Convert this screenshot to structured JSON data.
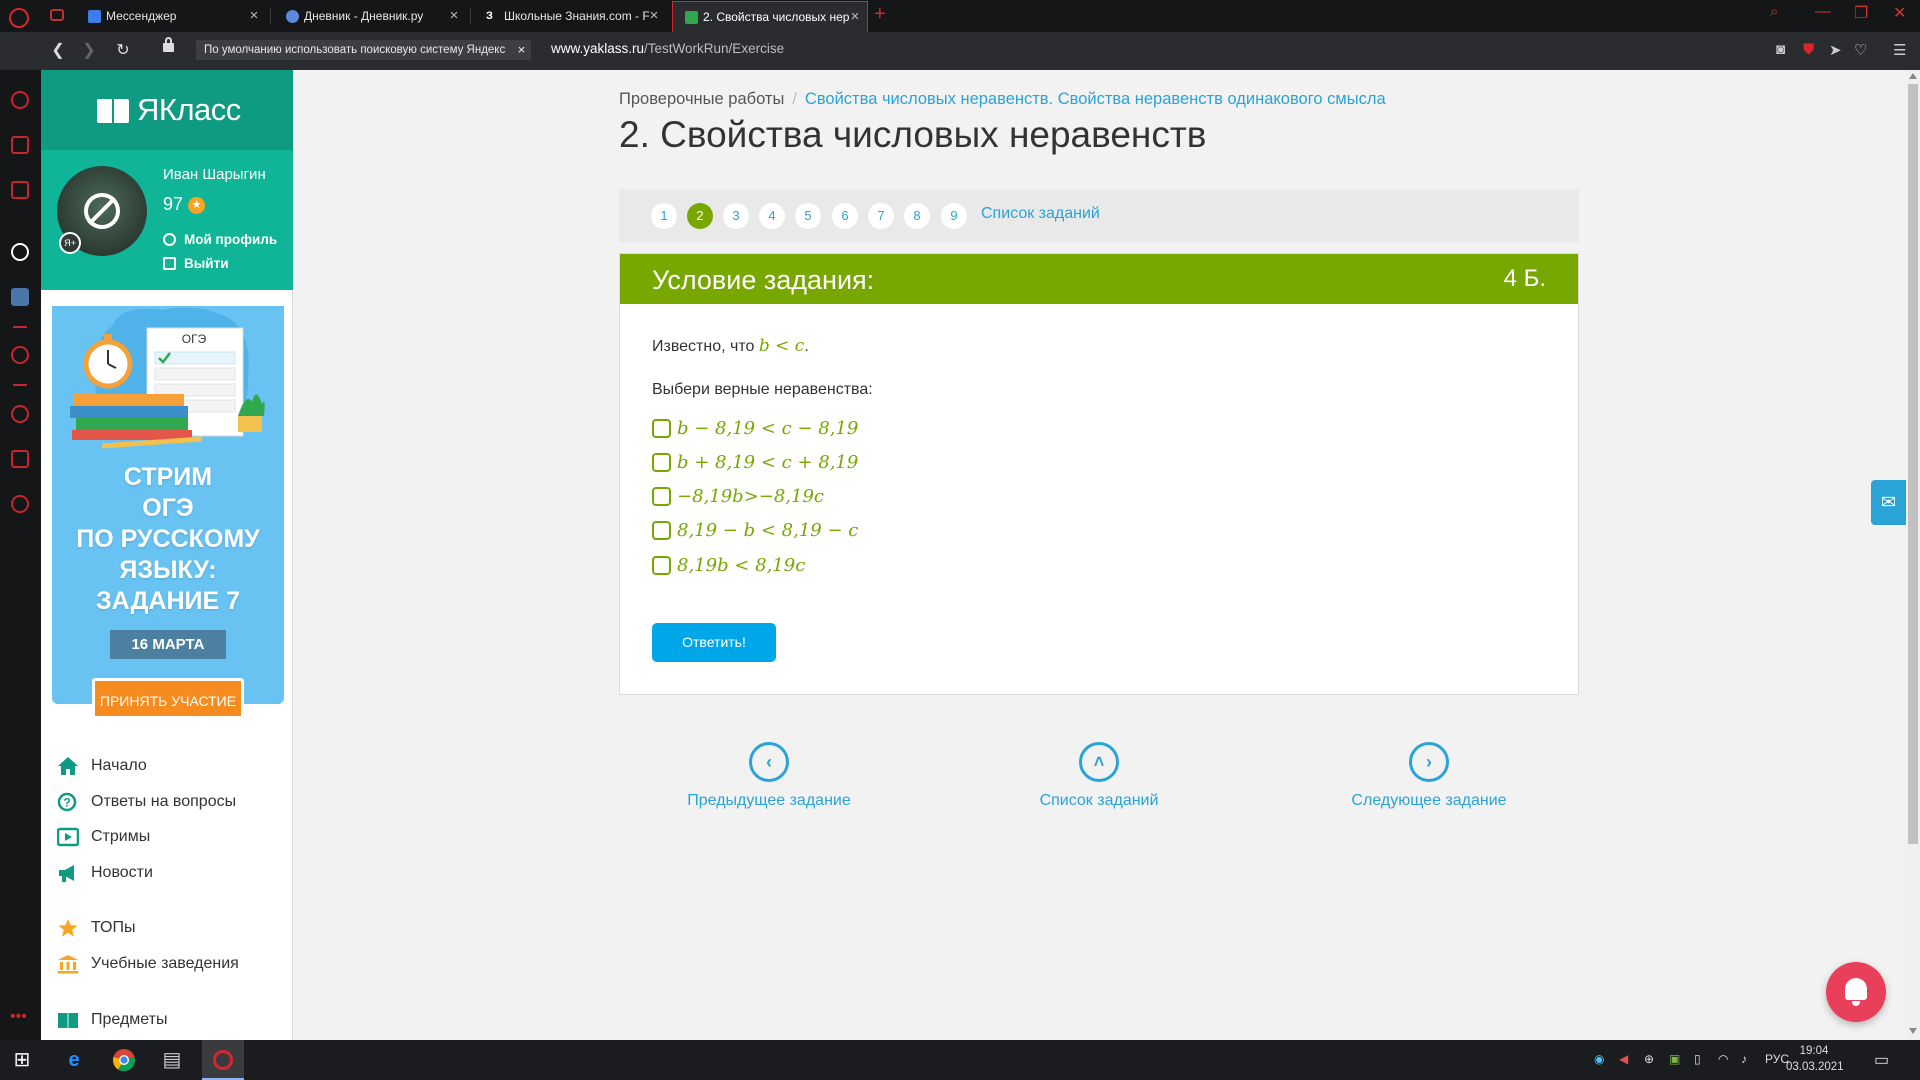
{
  "browser": {
    "tabs": [
      {
        "label": "Мессенджер",
        "fav_color": "#3b7de9"
      },
      {
        "label": "Дневник - Дневник.ру",
        "fav_color": "#5a8ad8"
      },
      {
        "label": "Школьные Знания.com - F",
        "fav_color": "#1a1a1a",
        "fav_text": "З"
      },
      {
        "label": "2. Свойства числовых нер",
        "fav_color": "#2fa84f"
      }
    ],
    "search_hint": "По умолчанию использовать поисковую систему Яндекс",
    "search_hint_close": "×",
    "url_host": "www.yaklass.ru",
    "url_path": "/TestWorkRun/Exercise"
  },
  "sidebar": {
    "logo_text": "ЯКласс",
    "user_name": "Иван Шарыгин",
    "points": "97",
    "avatar_badge": "Я+",
    "profile_link": "Мой профиль",
    "logout_link": "Выйти",
    "promo": {
      "sheet_label": "ОГЭ",
      "title_lines": [
        "СТРИМ",
        "ОГЭ",
        "ПО РУССКОМУ",
        "ЯЗЫКУ:",
        "ЗАДАНИЕ 7"
      ],
      "date": "16 МАРТА",
      "button": "ПРИНЯТЬ УЧАСТИЕ"
    },
    "menu": [
      {
        "label": "Начало",
        "icon": "home-icon"
      },
      {
        "label": "Ответы на вопросы",
        "icon": "question-icon"
      },
      {
        "label": "Стримы",
        "icon": "play-icon"
      },
      {
        "label": "Новости",
        "icon": "megaphone-icon"
      },
      {
        "label": "ТОПы",
        "icon": "star-icon"
      },
      {
        "label": "Учебные заведения",
        "icon": "building-icon"
      },
      {
        "label": "Предметы",
        "icon": "books-icon"
      }
    ]
  },
  "main": {
    "breadcrumb": {
      "root": "Проверочные работы",
      "current": "Свойства числовых неравенств. Свойства неравенств одинакового смысла"
    },
    "title": "2. Свойства числовых неравенств",
    "pager": {
      "pages": [
        "1",
        "2",
        "3",
        "4",
        "5",
        "6",
        "7",
        "8",
        "9"
      ],
      "current": "2",
      "list_link": "Список заданий"
    },
    "task": {
      "header": "Условие задания:",
      "points": "4 Б.",
      "known_prefix": "Известно, что ",
      "known_math": "b < c",
      "known_suffix": ".",
      "question": "Выбери верные неравенства:",
      "options": [
        "b − 8,19 < c − 8,19",
        "b + 8,19 < c + 8,19",
        "−8,19b>−8,19c",
        "8,19 − b < 8,19 − c",
        "8,19b < 8,19c"
      ],
      "answer_button": "Ответить!"
    },
    "nav": {
      "prev": "Предыдущее задание",
      "list": "Список заданий",
      "next": "Следующее задание"
    }
  },
  "taskbar": {
    "language": "РУС",
    "time": "19:04",
    "date": "03.03.2021"
  },
  "colors": {
    "brand_green": "#78a700",
    "link_blue": "#2aa3d7",
    "yaklass_teal": "#10b597",
    "opera_red": "#d7262d"
  }
}
